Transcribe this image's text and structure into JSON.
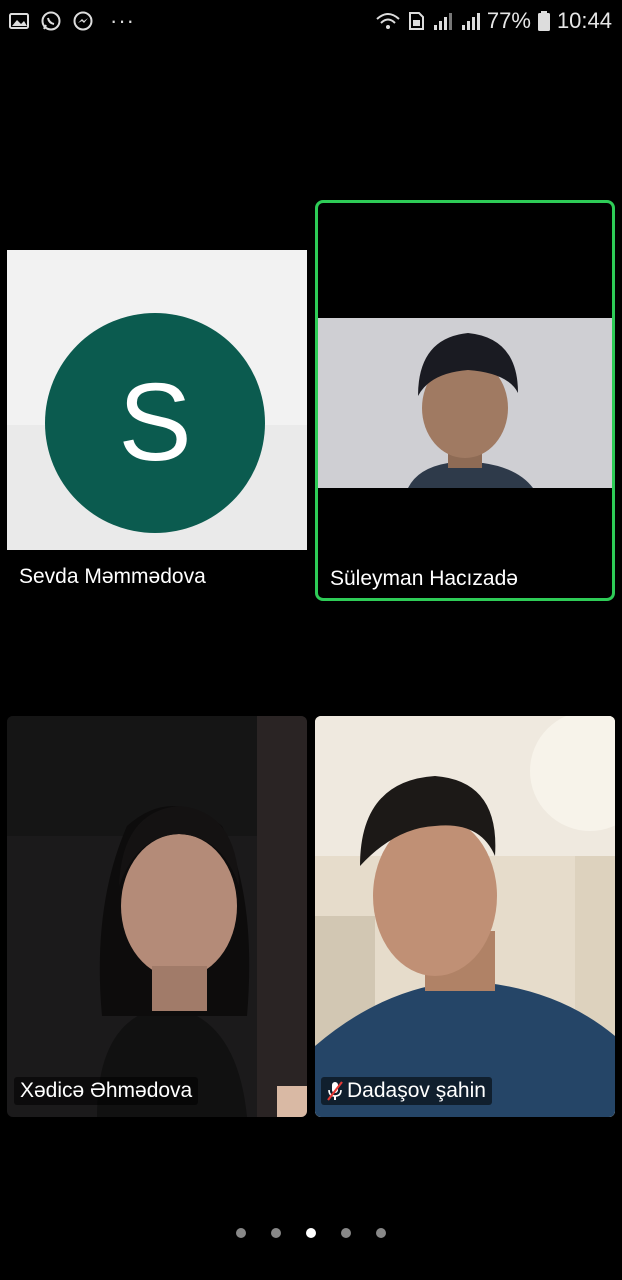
{
  "status_bar": {
    "battery": "77%",
    "time": "10:44"
  },
  "participants": [
    {
      "name": "Sevda Məmmədova",
      "avatar_letter": "S"
    },
    {
      "name": "Süleyman Hacızadə"
    },
    {
      "name": "Xədicə Əhmədova"
    },
    {
      "name": "Dadaşov şahin"
    }
  ],
  "colors": {
    "speaker_border": "#2ecc57",
    "avatar_bg": "#0b5b4f"
  }
}
